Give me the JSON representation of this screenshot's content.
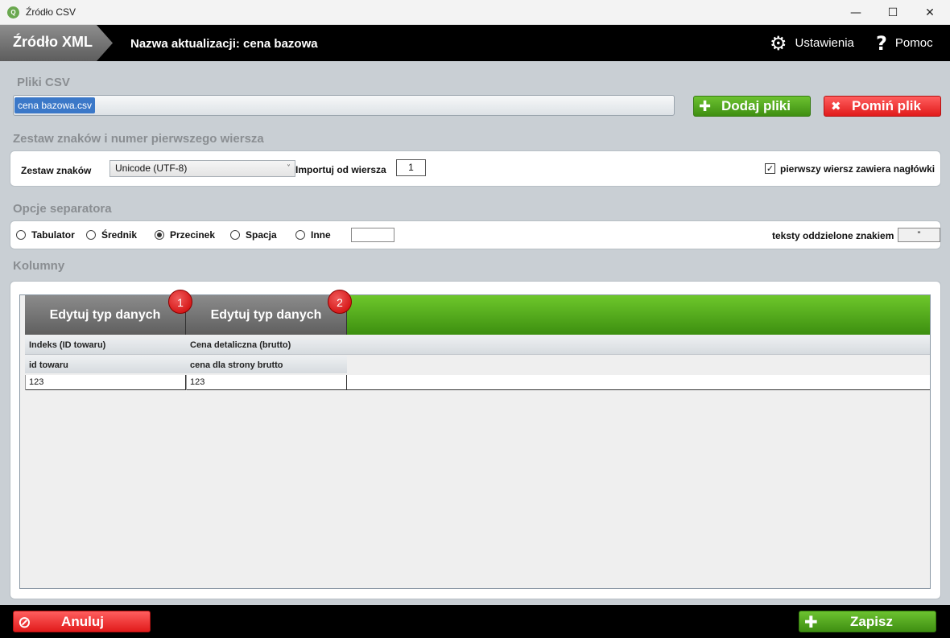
{
  "window": {
    "title": "Źródło CSV",
    "app_icon": "csv-app-icon",
    "controls": {
      "minimize": "—",
      "maximize": "☐",
      "close": "✕"
    }
  },
  "header": {
    "brand": "Źródło XML",
    "update_title": "Nazwa aktualizacji: cena bazowa",
    "settings_label": "Ustawienia",
    "settings_icon": "⚙",
    "help_label": "Pomoc",
    "help_icon": "?"
  },
  "files": {
    "section_label": "Pliki CSV",
    "selected_file": "cena bazowa.csv",
    "add_button": "Dodaj pliki",
    "add_icon": "✚",
    "skip_button": "Pomiń plik",
    "skip_icon": "✖"
  },
  "charset": {
    "section_label": "Zestaw znaków i numer pierwszego wiersza",
    "charset_label": "Zestaw znaków",
    "charset_value": "Unicode (UTF-8)",
    "chevron": "˅",
    "import_from_label": "Importuj od wiersza",
    "import_from_value": "1",
    "header_row_label": "pierwszy wiersz zawiera nagłówki",
    "header_row_checked": "✓"
  },
  "separator": {
    "section_label": "Opcje separatora",
    "options": [
      "Tabulator",
      "Średnik",
      "Przecinek",
      "Spacja",
      "Inne"
    ],
    "selected": "Przecinek",
    "text_qualifier_label": "teksty oddzielone znakiem",
    "text_qualifier_value": "\""
  },
  "columns": {
    "section_label": "Kolumny",
    "accent_color": "#4fa51c",
    "items": [
      {
        "edit_label": "Edytuj typ danych",
        "badge": "1",
        "source_name": "Indeks (ID towaru)",
        "target_name": "id towaru",
        "sample": "123"
      },
      {
        "edit_label": "Edytuj typ danych",
        "badge": "2",
        "source_name": "Cena detaliczna (brutto)",
        "target_name": "cena dla strony brutto",
        "sample": "123"
      }
    ]
  },
  "footer": {
    "cancel_label": "Anuluj",
    "cancel_icon": "⊘",
    "save_label": "Zapisz",
    "save_icon": "✚"
  }
}
